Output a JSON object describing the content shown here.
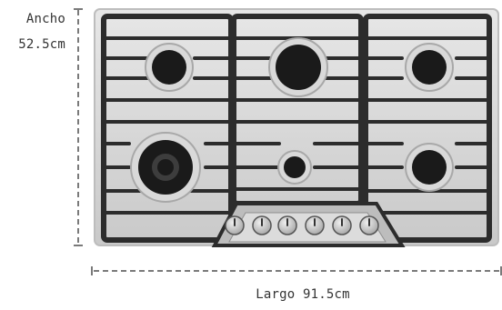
{
  "dimensions": {
    "width_label": "Ancho",
    "width_value": "52.5cm",
    "length_label": "Largo 91.5cm"
  },
  "colors": {
    "steel": "#cfcfcf",
    "grate": "#2c2c2c",
    "burner": "#1a1a1a",
    "dimension_line": "#7a7a7a",
    "text": "#333333"
  },
  "hob": {
    "burner_count": 6,
    "knob_count": 6
  }
}
